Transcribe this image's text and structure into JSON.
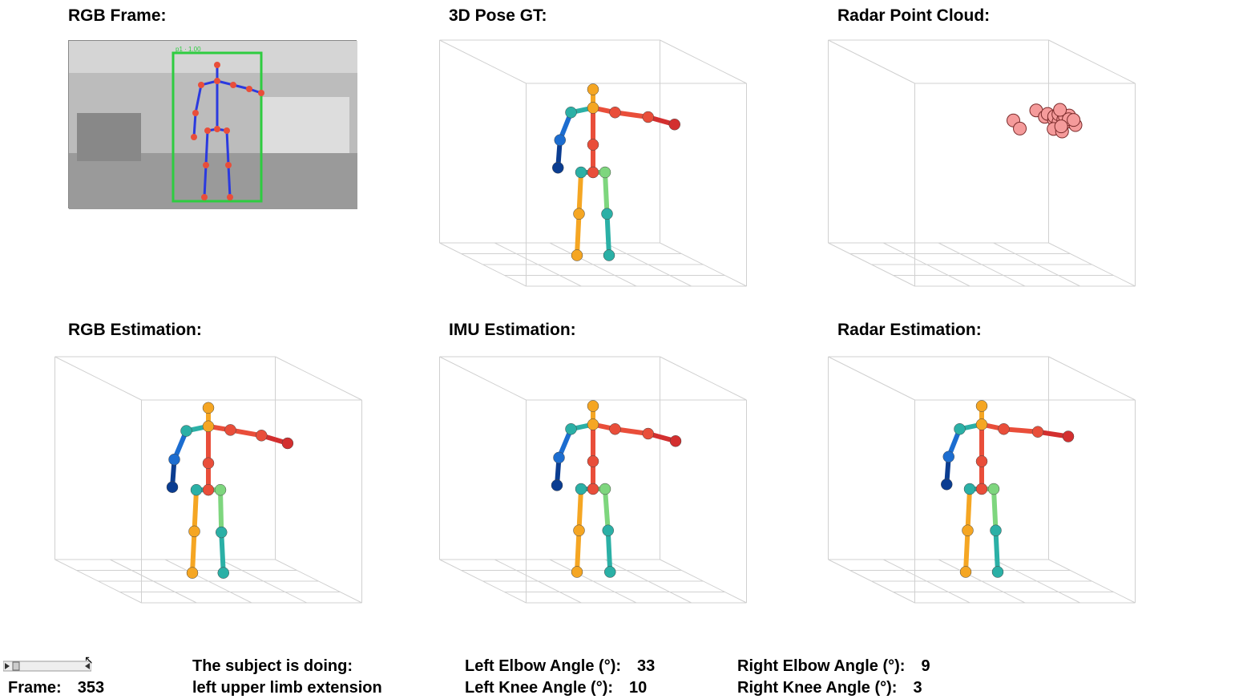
{
  "titles": {
    "rgb_frame": "RGB Frame:",
    "pose_gt": "3D Pose GT:",
    "radar_pc": "Radar Point Cloud:",
    "rgb_est": "RGB Estimation:",
    "imu_est": "IMU Estimation:",
    "radar_est": "Radar Estimation:"
  },
  "bottom": {
    "frame_label": "Frame:",
    "frame_value": "353",
    "action_l1": "The subject is doing:",
    "action_l2": "left upper limb extension",
    "le_label": "Left Elbow Angle (°):",
    "le_val": "33",
    "lk_label": "Left Knee Angle (°):",
    "lk_val": "10",
    "re_label": "Right Elbow Angle (°):",
    "re_val": "9",
    "rk_label": "Right Knee Angle (°):",
    "rk_val": "3"
  },
  "chart_data": {
    "skeleton_joints": [
      "head",
      "neck",
      "r_shoulder",
      "r_elbow",
      "r_wrist",
      "l_shoulder",
      "l_elbow",
      "l_wrist",
      "spine",
      "pelvis",
      "r_hip",
      "r_knee",
      "r_ankle",
      "l_hip",
      "l_knee",
      "l_ankle"
    ],
    "skeleton_bones": [
      [
        "head",
        "neck"
      ],
      [
        "neck",
        "r_shoulder"
      ],
      [
        "neck",
        "l_shoulder"
      ],
      [
        "r_shoulder",
        "r_elbow"
      ],
      [
        "r_elbow",
        "r_wrist"
      ],
      [
        "l_shoulder",
        "l_elbow"
      ],
      [
        "l_elbow",
        "l_wrist"
      ],
      [
        "neck",
        "spine"
      ],
      [
        "spine",
        "pelvis"
      ],
      [
        "pelvis",
        "r_hip"
      ],
      [
        "pelvis",
        "l_hip"
      ],
      [
        "r_hip",
        "r_knee"
      ],
      [
        "r_knee",
        "r_ankle"
      ],
      [
        "l_hip",
        "l_knee"
      ],
      [
        "l_knee",
        "l_ankle"
      ]
    ],
    "bone_colors": {
      "head-neck": "#f5a623",
      "neck-r_shoulder": "#2bb0a6",
      "neck-l_shoulder": "#e94e3a",
      "r_shoulder-r_elbow": "#1c6dd0",
      "r_elbow-r_wrist": "#0b3d91",
      "l_shoulder-l_elbow": "#e94e3a",
      "l_elbow-l_wrist": "#d32f2f",
      "neck-spine": "#e94e3a",
      "spine-pelvis": "#e94e3a",
      "pelvis-r_hip": "#2bb0a6",
      "pelvis-l_hip": "#7ed67e",
      "r_hip-r_knee": "#f5a623",
      "r_knee-r_ankle": "#f5a623",
      "l_hip-l_knee": "#7ed67e",
      "l_knee-l_ankle": "#2bb0a6"
    },
    "poses": {
      "gt": {
        "head": [
          0,
          0,
          190
        ],
        "neck": [
          0,
          0,
          170
        ],
        "r_shoulder": [
          -22,
          0,
          165
        ],
        "r_elbow": [
          -33,
          0,
          135
        ],
        "r_wrist": [
          -35,
          0,
          105
        ],
        "l_shoulder": [
          22,
          0,
          165
        ],
        "l_elbow": [
          55,
          0,
          160
        ],
        "l_wrist": [
          85,
          -5,
          150
        ],
        "spine": [
          0,
          0,
          130
        ],
        "pelvis": [
          0,
          0,
          100
        ],
        "r_hip": [
          -12,
          0,
          100
        ],
        "r_knee": [
          -14,
          0,
          55
        ],
        "r_ankle": [
          -16,
          0,
          10
        ],
        "l_hip": [
          12,
          0,
          100
        ],
        "l_knee": [
          14,
          0,
          55
        ],
        "l_ankle": [
          16,
          0,
          10
        ]
      },
      "rgb": {
        "head": [
          0,
          0,
          188
        ],
        "neck": [
          0,
          0,
          168
        ],
        "r_shoulder": [
          -22,
          0,
          163
        ],
        "r_elbow": [
          -34,
          0,
          132
        ],
        "r_wrist": [
          -36,
          0,
          102
        ],
        "l_shoulder": [
          22,
          0,
          164
        ],
        "l_elbow": [
          53,
          0,
          158
        ],
        "l_wrist": [
          82,
          -4,
          148
        ],
        "spine": [
          0,
          0,
          128
        ],
        "pelvis": [
          0,
          0,
          99
        ],
        "r_hip": [
          -12,
          0,
          99
        ],
        "r_knee": [
          -14,
          0,
          54
        ],
        "r_ankle": [
          -16,
          0,
          9
        ],
        "l_hip": [
          12,
          0,
          99
        ],
        "l_knee": [
          13,
          0,
          53
        ],
        "l_ankle": [
          15,
          0,
          9
        ]
      },
      "imu": {
        "head": [
          0,
          0,
          190
        ],
        "neck": [
          0,
          0,
          170
        ],
        "r_shoulder": [
          -22,
          0,
          165
        ],
        "r_elbow": [
          -34,
          0,
          134
        ],
        "r_wrist": [
          -36,
          0,
          104
        ],
        "l_shoulder": [
          22,
          0,
          165
        ],
        "l_elbow": [
          55,
          0,
          160
        ],
        "l_wrist": [
          86,
          -5,
          150
        ],
        "spine": [
          0,
          0,
          130
        ],
        "pelvis": [
          0,
          0,
          100
        ],
        "r_hip": [
          -12,
          0,
          100
        ],
        "r_knee": [
          -14,
          0,
          55
        ],
        "r_ankle": [
          -16,
          0,
          10
        ],
        "l_hip": [
          12,
          0,
          100
        ],
        "l_knee": [
          15,
          0,
          55
        ],
        "l_ankle": [
          17,
          0,
          10
        ]
      },
      "radar": {
        "head": [
          0,
          0,
          190
        ],
        "neck": [
          0,
          0,
          170
        ],
        "r_shoulder": [
          -22,
          0,
          165
        ],
        "r_elbow": [
          -33,
          0,
          135
        ],
        "r_wrist": [
          -35,
          0,
          105
        ],
        "l_shoulder": [
          22,
          0,
          165
        ],
        "l_elbow": [
          56,
          0,
          162
        ],
        "l_wrist": [
          90,
          -5,
          155
        ],
        "spine": [
          0,
          0,
          130
        ],
        "pelvis": [
          0,
          0,
          100
        ],
        "r_hip": [
          -12,
          0,
          100
        ],
        "r_knee": [
          -14,
          0,
          55
        ],
        "r_ankle": [
          -16,
          0,
          10
        ],
        "l_hip": [
          12,
          0,
          100
        ],
        "l_knee": [
          14,
          0,
          55
        ],
        "l_ankle": [
          16,
          0,
          10
        ]
      }
    },
    "radar_points": [
      [
        40,
        20,
        175
      ],
      [
        45,
        25,
        170
      ],
      [
        50,
        22,
        172
      ],
      [
        52,
        28,
        168
      ],
      [
        55,
        24,
        170
      ],
      [
        58,
        26,
        165
      ],
      [
        60,
        23,
        172
      ],
      [
        62,
        27,
        168
      ],
      [
        65,
        25,
        170
      ],
      [
        68,
        28,
        166
      ],
      [
        70,
        24,
        171
      ],
      [
        72,
        30,
        163
      ],
      [
        48,
        33,
        160
      ],
      [
        55,
        35,
        158
      ],
      [
        10,
        30,
        168
      ],
      [
        15,
        32,
        160
      ],
      [
        63,
        21,
        176
      ],
      [
        66,
        29,
        169
      ],
      [
        73,
        26,
        167
      ],
      [
        57,
        31,
        162
      ]
    ],
    "radar_point_color": "#f59b9b",
    "axes": {
      "xrange": [
        -110,
        110
      ],
      "yrange": [
        -60,
        60
      ],
      "zrange": [
        0,
        220
      ]
    }
  }
}
